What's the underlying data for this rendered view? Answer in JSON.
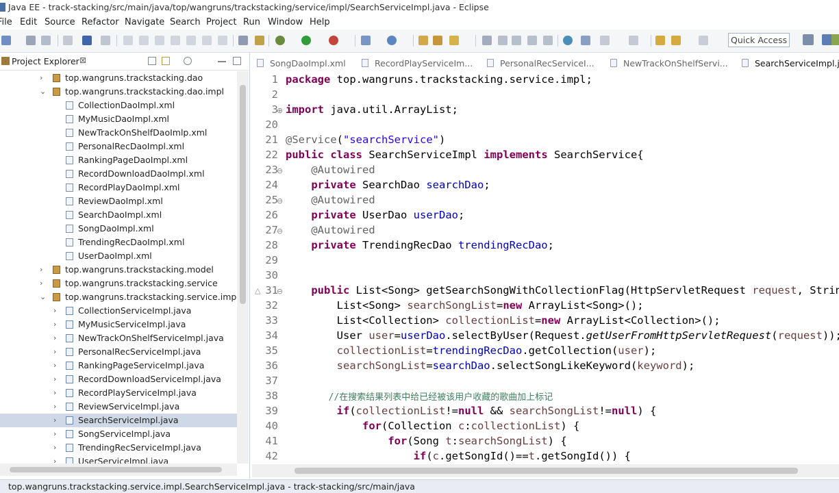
{
  "window": {
    "title": "Java EE - track-stacking/src/main/java/top/wangruns/trackstacking/service/impl/SearchServiceImpl.java - Eclipse"
  },
  "menu": [
    "File",
    "Edit",
    "Source",
    "Refactor",
    "Navigate",
    "Search",
    "Project",
    "Run",
    "Window",
    "Help"
  ],
  "toolbar": {
    "quick_access": "Quick Access"
  },
  "explorer": {
    "title": "Project Explorer",
    "close": "⊠",
    "items": [
      {
        "label": "top.wangruns.trackstacking.dao",
        "type": "pkg",
        "indent": 0,
        "arrow": "›"
      },
      {
        "label": "top.wangruns.trackstacking.dao.impl",
        "type": "pkg",
        "indent": 0,
        "arrow": "⌄"
      },
      {
        "label": "CollectionDaoImpl.xml",
        "type": "xml",
        "indent": 1
      },
      {
        "label": "MyMusicDaoImpl.xml",
        "type": "xml",
        "indent": 1
      },
      {
        "label": "NewTrackOnShelfDaoImlp.xml",
        "type": "xml",
        "indent": 1
      },
      {
        "label": "PersonalRecDaoImpl.xml",
        "type": "xml",
        "indent": 1
      },
      {
        "label": "RankingPageDaoImpl.xml",
        "type": "xml",
        "indent": 1
      },
      {
        "label": "RecordDownloadDaoImpl.xml",
        "type": "xml",
        "indent": 1
      },
      {
        "label": "RecordPlayDaoImpl.xml",
        "type": "xml",
        "indent": 1
      },
      {
        "label": "ReviewDaoImpl.xml",
        "type": "xml",
        "indent": 1
      },
      {
        "label": "SearchDaoImpl.xml",
        "type": "xml",
        "indent": 1
      },
      {
        "label": "SongDaoImpl.xml",
        "type": "xml",
        "indent": 1
      },
      {
        "label": "TrendingRecDaoImpl.xml",
        "type": "xml",
        "indent": 1
      },
      {
        "label": "UserDaoImpl.xml",
        "type": "xml",
        "indent": 1
      },
      {
        "label": "top.wangruns.trackstacking.model",
        "type": "pkg",
        "indent": 0,
        "arrow": "›"
      },
      {
        "label": "top.wangruns.trackstacking.service",
        "type": "pkg",
        "indent": 0,
        "arrow": "›"
      },
      {
        "label": "top.wangruns.trackstacking.service.impl",
        "type": "pkg",
        "indent": 0,
        "arrow": "⌄"
      },
      {
        "label": "CollectionServiceImpl.java",
        "type": "java",
        "indent": 1,
        "arrow": "›"
      },
      {
        "label": "MyMusicServiceImpl.java",
        "type": "java",
        "indent": 1,
        "arrow": "›"
      },
      {
        "label": "NewTrackOnShelfServiceImpl.java",
        "type": "java",
        "indent": 1,
        "arrow": "›"
      },
      {
        "label": "PersonalRecServiceImpl.java",
        "type": "java",
        "indent": 1,
        "arrow": "›"
      },
      {
        "label": "RankingPageServiceImpl.java",
        "type": "java",
        "indent": 1,
        "arrow": "›"
      },
      {
        "label": "RecordDownloadServiceImpl.java",
        "type": "java",
        "indent": 1,
        "arrow": "›"
      },
      {
        "label": "RecordPlayServiceImpl.java",
        "type": "java",
        "indent": 1,
        "arrow": "›"
      },
      {
        "label": "ReviewServiceImpl.java",
        "type": "java",
        "indent": 1,
        "arrow": "›"
      },
      {
        "label": "SearchServiceImpl.java",
        "type": "java",
        "indent": 1,
        "arrow": "›",
        "selected": true
      },
      {
        "label": "SongServiceImpl.java",
        "type": "java",
        "indent": 1,
        "arrow": "›"
      },
      {
        "label": "TrendingRecServiceImpl.java",
        "type": "java",
        "indent": 1,
        "arrow": "›"
      },
      {
        "label": "UserServiceImpl.java",
        "type": "java",
        "indent": 1,
        "arrow": "›"
      }
    ]
  },
  "tabs": [
    {
      "label": "SongDaoImpl.xml",
      "active": false
    },
    {
      "label": "RecordPlayServiceIm...",
      "active": false
    },
    {
      "label": "PersonalRecServiceI...",
      "active": false
    },
    {
      "label": "NewTrackOnShelfServi...",
      "active": false
    },
    {
      "label": "SearchServiceImpl.j...",
      "active": true
    }
  ],
  "editor": {
    "lines": [
      {
        "n": "1",
        "text": "package top.wangruns.trackstacking.service.impl;"
      },
      {
        "n": "2",
        "text": ""
      },
      {
        "n": "3",
        "text": "import java.util.ArrayList;",
        "fold": "⊕"
      },
      {
        "n": "20",
        "text": ""
      },
      {
        "n": "21",
        "text": "@Service(\"searchService\")"
      },
      {
        "n": "22",
        "text": "public class SearchServiceImpl implements SearchService{"
      },
      {
        "n": "23",
        "text": "    @Autowired",
        "fold": "⊖"
      },
      {
        "n": "24",
        "text": "    private SearchDao searchDao;"
      },
      {
        "n": "25",
        "text": "    @Autowired",
        "fold": "⊖"
      },
      {
        "n": "26",
        "text": "    private UserDao userDao;"
      },
      {
        "n": "27",
        "text": "    @Autowired",
        "fold": "⊖"
      },
      {
        "n": "28",
        "text": "    private TrendingRecDao trendingRecDao;"
      },
      {
        "n": "29",
        "text": ""
      },
      {
        "n": "30",
        "text": ""
      },
      {
        "n": "31",
        "text": "    public List<Song> getSearchSongWithCollectionFlag(HttpServletRequest request, String keyword) {",
        "fold": "⊖",
        "marker": "△"
      },
      {
        "n": "32",
        "text": "        List<Song> searchSongList=new ArrayList<Song>();"
      },
      {
        "n": "33",
        "text": "        List<Collection> collectionList=new ArrayList<Collection>();"
      },
      {
        "n": "34",
        "text": "        User user=userDao.selectByUser(Request.getUserFromHttpServletRequest(request));"
      },
      {
        "n": "35",
        "text": "        collectionList=trendingRecDao.getCollection(user);"
      },
      {
        "n": "36",
        "text": "        searchSongList=searchDao.selectSongLikeKeyword(keyword);"
      },
      {
        "n": "37",
        "text": ""
      },
      {
        "n": "38",
        "text": "        //在搜索结果列表中给已经被该用户收藏的歌曲加上标记"
      },
      {
        "n": "39",
        "text": "        if(collectionList!=null && searchSongList!=null) {"
      },
      {
        "n": "40",
        "text": "            for(Collection c:collectionList) {"
      },
      {
        "n": "41",
        "text": "                for(Song t:searchSongList) {"
      },
      {
        "n": "42",
        "text": "                    if(c.getSongId()==t.getSongId()) {"
      }
    ]
  },
  "status": {
    "text": "top.wangruns.trackstacking.service.impl.SearchServiceImpl.java - track-stacking/src/main/java"
  }
}
